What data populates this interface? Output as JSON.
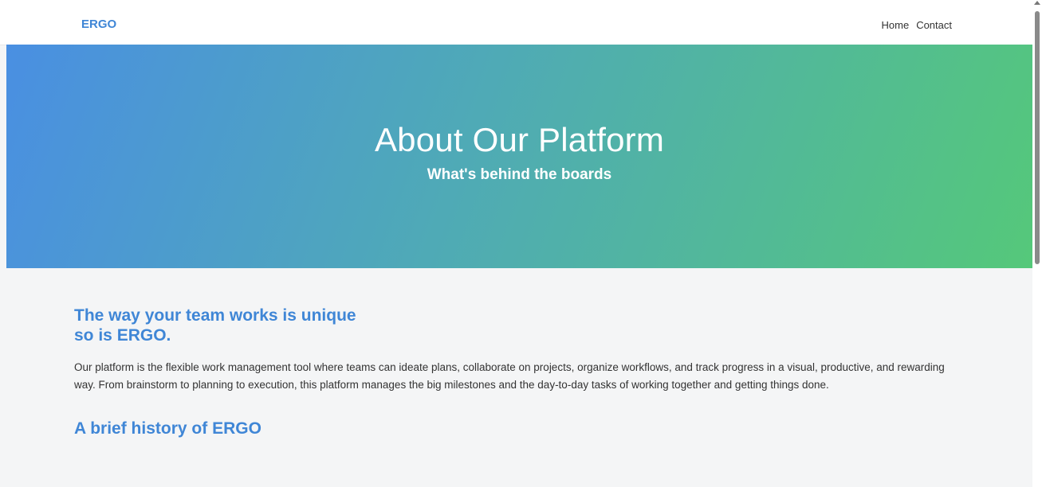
{
  "nav": {
    "brand": "ERGO",
    "links": [
      "Home",
      "Contact"
    ]
  },
  "hero": {
    "title": "About Our Platform",
    "subtitle": "What's behind the boards",
    "gradient_colors": [
      "#4a8fe2",
      "#4faab6",
      "#55c87a"
    ]
  },
  "intro": {
    "heading_line1": "The way your team works is unique",
    "heading_line2": "so is ERGO.",
    "body": "Our platform is the flexible work management tool where teams can ideate plans, collaborate on projects, organize workflows, and track progress in a visual, productive, and rewarding way. From brainstorm to planning to execution, this platform manages the big milestones and the day-to-day tasks of working together and getting things done."
  },
  "history": {
    "heading": "A brief history of ERGO"
  },
  "colors": {
    "accent": "#3f86d6",
    "background": "#f4f5f6"
  }
}
